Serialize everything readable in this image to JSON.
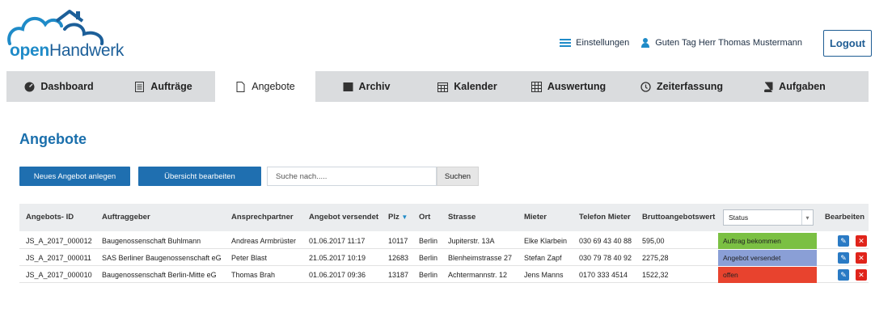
{
  "brand": {
    "open": "open",
    "rest": "Handwerk",
    "color": "#1f8bc8"
  },
  "header": {
    "settings_label": "Einstellungen",
    "greeting": "Guten Tag Herr Thomas Mustermann",
    "logout_label": "Logout"
  },
  "nav": {
    "tabs": [
      {
        "label": "Dashboard",
        "icon": "dashboard-icon"
      },
      {
        "label": "Aufträge",
        "icon": "document-list-icon"
      },
      {
        "label": "Angebote",
        "icon": "document-icon",
        "active": true
      },
      {
        "label": "Archiv",
        "icon": "archive-icon"
      },
      {
        "label": "Kalender",
        "icon": "calendar-icon"
      },
      {
        "label": "Auswertung",
        "icon": "spreadsheet-icon"
      },
      {
        "label": "Zeiterfassung",
        "icon": "clock-icon"
      },
      {
        "label": "Aufgaben",
        "icon": "book-icon"
      }
    ]
  },
  "page": {
    "title": "Angebote",
    "new_button": "Neues Angebot anlegen",
    "edit_overview_button": "Übersicht bearbeiten",
    "search_placeholder": "Suche nach.....",
    "search_button": "Suchen"
  },
  "table": {
    "headers": {
      "id": "Angebots- ID",
      "client": "Auftraggeber",
      "contact": "Ansprechpartner",
      "sent": "Angebot versendet",
      "plz": "Plz",
      "city": "Ort",
      "street": "Strasse",
      "tenant": "Mieter",
      "phone": "Telefon Mieter",
      "gross": "Bruttoangebotswert",
      "status": "Status",
      "edit": "Bearbeiten"
    },
    "rows": [
      {
        "id": "JS_A_2017_000012",
        "client": "Baugenossenschaft Buhlmann",
        "contact": "Andreas Armbrüster",
        "sent": "01.06.2017 11:17",
        "plz": "10117",
        "city": "Berlin",
        "street": "Jupiterstr. 13A",
        "tenant": "Elke Klarbein",
        "phone": "030 69 43 40 88",
        "gross": "595,00",
        "status": "Auftrag bekommen",
        "status_color": "#7bc043"
      },
      {
        "id": "JS_A_2017_000011",
        "client": "SAS Berliner Baugenossenschaft eG",
        "contact": "Peter Blast",
        "sent": "21.05.2017 10:19",
        "plz": "12683",
        "city": "Berlin",
        "street": "Blenheimstrasse 27",
        "tenant": "Stefan Zapf",
        "phone": "030 79 78 40 92",
        "gross": "2275,28",
        "status": "Angebot versendet",
        "status_color": "#8a9fd6"
      },
      {
        "id": "JS_A_2017_000010",
        "client": "Baugenossenschaft Berlin-Mitte eG",
        "contact": "Thomas Brah",
        "sent": "01.06.2017 09:36",
        "plz": "13187",
        "city": "Berlin",
        "street": "Achtermannstr. 12",
        "tenant": "Jens Manns",
        "phone": "0170 333 4514",
        "gross": "1522,32",
        "status": "offen",
        "status_color": "#e8432e"
      }
    ]
  },
  "colors": {
    "primary": "#1f6fb0",
    "nav_bg": "#dadcde",
    "edit": "#2a7ac4",
    "delete": "#e0241b"
  }
}
